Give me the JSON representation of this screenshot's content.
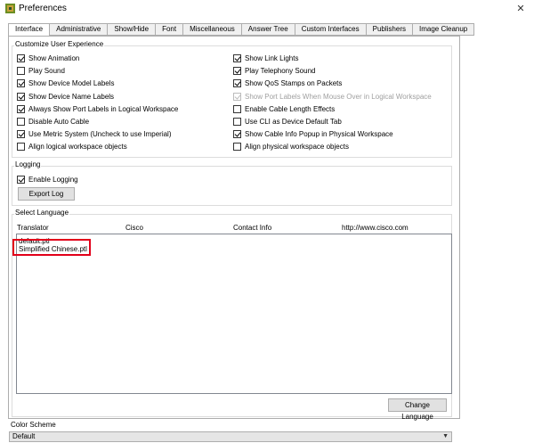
{
  "window": {
    "title": "Preferences"
  },
  "tabs": [
    {
      "label": "Interface"
    },
    {
      "label": "Administrative"
    },
    {
      "label": "Show/Hide"
    },
    {
      "label": "Font"
    },
    {
      "label": "Miscellaneous"
    },
    {
      "label": "Answer Tree"
    },
    {
      "label": "Custom Interfaces"
    },
    {
      "label": "Publishers"
    },
    {
      "label": "Image Cleanup"
    }
  ],
  "customize": {
    "title": "Customize User Experience",
    "left": [
      {
        "label": "Show Animation",
        "checked": true
      },
      {
        "label": "Play Sound",
        "checked": false
      },
      {
        "label": "Show Device Model Labels",
        "checked": true
      },
      {
        "label": "Show Device Name Labels",
        "checked": true
      },
      {
        "label": "Always Show Port Labels in Logical Workspace",
        "checked": true
      },
      {
        "label": "Disable Auto Cable",
        "checked": false
      },
      {
        "label": "Use Metric System (Uncheck to use Imperial)",
        "checked": true
      },
      {
        "label": "Align logical workspace objects",
        "checked": false
      }
    ],
    "right": [
      {
        "label": "Show Link Lights",
        "checked": true
      },
      {
        "label": "Play Telephony Sound",
        "checked": true
      },
      {
        "label": "Show QoS Stamps on Packets",
        "checked": true
      },
      {
        "label": "Show Port Labels When Mouse Over in Logical Workspace",
        "checked": true,
        "disabled": true
      },
      {
        "label": "Enable Cable Length Effects",
        "checked": false
      },
      {
        "label": "Use CLI as Device Default Tab",
        "checked": false
      },
      {
        "label": "Show Cable Info Popup in Physical Workspace",
        "checked": true
      },
      {
        "label": "Align physical workspace objects",
        "checked": false
      }
    ]
  },
  "logging": {
    "title": "Logging",
    "enable_label": "Enable Logging",
    "enable_checked": true,
    "export_label": "Export Log"
  },
  "language": {
    "title": "Select Language",
    "headers": {
      "translator": "Translator",
      "company": "Cisco",
      "contact": "Contact Info",
      "url": "http://www.cisco.com"
    },
    "items": [
      "default.ptl",
      "Simplified Chinese.ptl"
    ],
    "change_label": "Change Language"
  },
  "color_scheme": {
    "label": "Color Scheme",
    "value": "Default"
  },
  "colors": {
    "highlight": "#e2001a"
  }
}
